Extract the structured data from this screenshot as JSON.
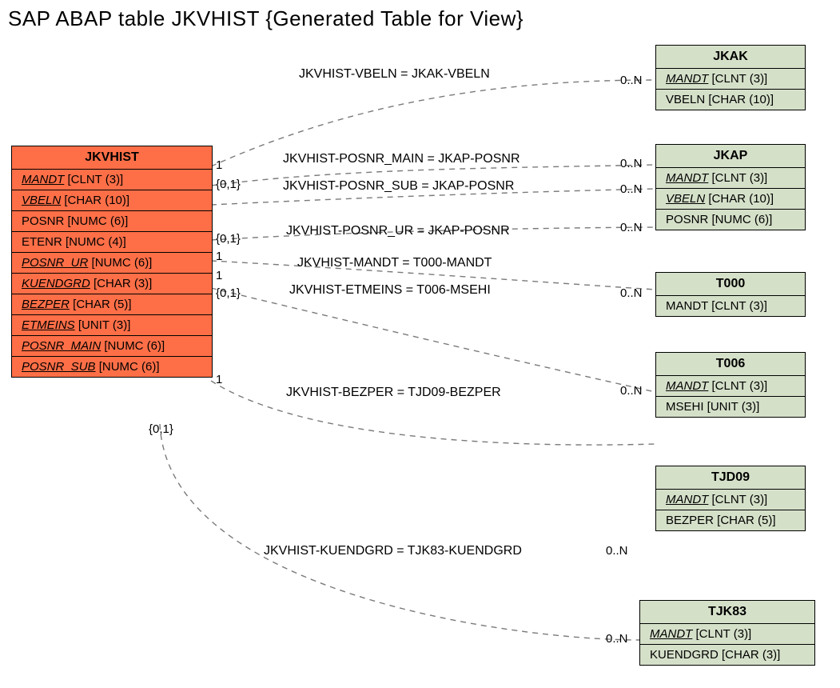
{
  "title": "SAP ABAP table JKVHIST {Generated Table for View}",
  "main_entity": {
    "name": "JKVHIST",
    "fields": [
      {
        "name": "MANDT",
        "type": "[CLNT (3)]",
        "fk": true
      },
      {
        "name": "VBELN",
        "type": "[CHAR (10)]",
        "fk": true
      },
      {
        "name": "POSNR",
        "type": "[NUMC (6)]",
        "fk": false
      },
      {
        "name": "ETENR",
        "type": "[NUMC (4)]",
        "fk": false
      },
      {
        "name": "POSNR_UR",
        "type": "[NUMC (6)]",
        "fk": true
      },
      {
        "name": "KUENDGRD",
        "type": "[CHAR (3)]",
        "fk": true
      },
      {
        "name": "BEZPER",
        "type": "[CHAR (5)]",
        "fk": true
      },
      {
        "name": "ETMEINS",
        "type": "[UNIT (3)]",
        "fk": true
      },
      {
        "name": "POSNR_MAIN",
        "type": "[NUMC (6)]",
        "fk": true
      },
      {
        "name": "POSNR_SUB",
        "type": "[NUMC (6)]",
        "fk": true
      }
    ]
  },
  "related_entities": [
    {
      "name": "JKAK",
      "fields": [
        {
          "name": "MANDT",
          "type": "[CLNT (3)]",
          "fk": true
        },
        {
          "name": "VBELN",
          "type": "[CHAR (10)]",
          "fk": false
        }
      ]
    },
    {
      "name": "JKAP",
      "fields": [
        {
          "name": "MANDT",
          "type": "[CLNT (3)]",
          "fk": true
        },
        {
          "name": "VBELN",
          "type": "[CHAR (10)]",
          "fk": true
        },
        {
          "name": "POSNR",
          "type": "[NUMC (6)]",
          "fk": false
        }
      ]
    },
    {
      "name": "T000",
      "fields": [
        {
          "name": "MANDT",
          "type": "[CLNT (3)]",
          "fk": false
        }
      ]
    },
    {
      "name": "T006",
      "fields": [
        {
          "name": "MANDT",
          "type": "[CLNT (3)]",
          "fk": true
        },
        {
          "name": "MSEHI",
          "type": "[UNIT (3)]",
          "fk": false
        }
      ]
    },
    {
      "name": "TJD09",
      "fields": [
        {
          "name": "MANDT",
          "type": "[CLNT (3)]",
          "fk": true
        },
        {
          "name": "BEZPER",
          "type": "[CHAR (5)]",
          "fk": false
        }
      ]
    },
    {
      "name": "TJK83",
      "fields": [
        {
          "name": "MANDT",
          "type": "[CLNT (3)]",
          "fk": true
        },
        {
          "name": "KUENDGRD",
          "type": "[CHAR (3)]",
          "fk": false
        }
      ]
    }
  ],
  "relations": [
    {
      "label": "JKVHIST-VBELN = JKAK-VBELN",
      "lc": "1",
      "rc": "0..N"
    },
    {
      "label": "JKVHIST-POSNR_MAIN = JKAP-POSNR",
      "lc": "{0,1}",
      "rc": "0..N"
    },
    {
      "label": "JKVHIST-POSNR_SUB = JKAP-POSNR",
      "lc": "",
      "rc": "0..N"
    },
    {
      "label": "JKVHIST-POSNR_UR = JKAP-POSNR",
      "lc": "{0,1}",
      "rc": "0..N"
    },
    {
      "label": "JKVHIST-MANDT = T000-MANDT",
      "lc": "1",
      "rc": ""
    },
    {
      "label": "JKVHIST-ETMEINS = T006-MSEHI",
      "lc": "1",
      "rc": "0..N"
    },
    {
      "label": "JKVHIST-BEZPER = TJD09-BEZPER",
      "lc": "{0,1}",
      "rc": "0..N"
    },
    {
      "label": "JKVHIST-KUENDGRD = TJK83-KUENDGRD",
      "lc": "{0,1}",
      "rc": "0..N"
    }
  ],
  "extra_left_card": "1"
}
